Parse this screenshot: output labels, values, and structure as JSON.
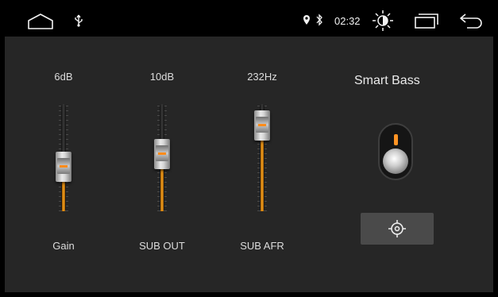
{
  "statusbar": {
    "time": "02:32",
    "icons": {
      "home": "home-icon",
      "usb": "usb-icon",
      "location": "location-pin-icon",
      "bluetooth": "bluetooth-icon",
      "brightness": "brightness-icon",
      "recents": "recent-apps-icon",
      "back": "back-icon"
    }
  },
  "sliders": [
    {
      "id": "gain",
      "value_label": "6dB",
      "name": "Gain",
      "level": 0.38
    },
    {
      "id": "sub-out",
      "value_label": "10dB",
      "name": "SUB OUT",
      "level": 0.55
    },
    {
      "id": "sub-afr",
      "value_label": "232Hz",
      "name": "SUB AFR",
      "level": 0.92
    }
  ],
  "smart_bass": {
    "title": "Smart Bass",
    "state": "on"
  },
  "colors": {
    "accent": "#f0a020",
    "background": "#262626",
    "statusbar": "#000000"
  }
}
